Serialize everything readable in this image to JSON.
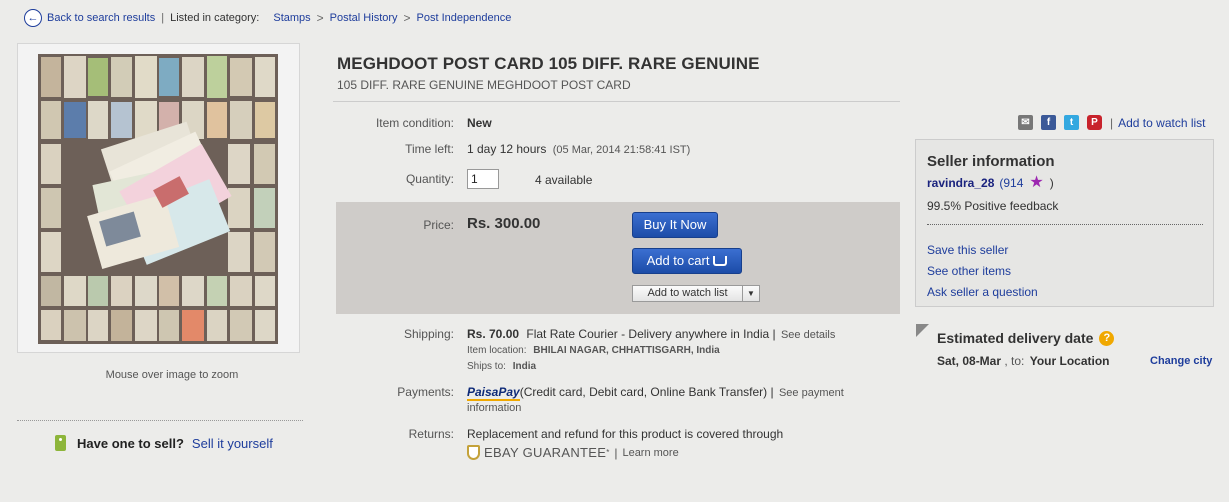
{
  "breadcrumb": {
    "back": "Back to search results",
    "sep": "|",
    "listed_in": "Listed in category:",
    "items": [
      "Stamps",
      "Postal History",
      "Post Independence"
    ],
    "gt": ">"
  },
  "image": {
    "zoom_hint": "Mouse over image to zoom"
  },
  "sell": {
    "question": "Have one to sell?",
    "link": "Sell it yourself"
  },
  "item": {
    "title": "MEGHDOOT POST CARD 105 DIFF. RARE GENUINE",
    "subtitle": "105 DIFF. RARE GENUINE MEGHDOOT POST CARD",
    "condition_label": "Item condition:",
    "condition": "New",
    "time_label": "Time left:",
    "time_left": "1 day 12 hours",
    "end_time": "(05 Mar, 2014  21:58:41 IST)",
    "qty_label": "Quantity:",
    "qty_value": "1",
    "available": "4 available",
    "price_label": "Price:",
    "price": "Rs. 300.00",
    "buy_now": "Buy It Now",
    "add_to_cart": "Add to cart",
    "add_watch": "Add to watch list",
    "shipping_label": "Shipping:",
    "shipping_cost": "Rs. 70.00",
    "shipping_desc": "Flat Rate Courier - Delivery anywhere in India |",
    "see_details": "See details",
    "item_location_label": "Item location:",
    "item_location": "BHILAI NAGAR, CHHATTISGARH, India",
    "ships_to_label": "Ships to:",
    "ships_to": "India",
    "payments_label": "Payments:",
    "paisapay": "PaisaPay",
    "payments_desc": "(Credit card, Debit card, Online Bank Transfer)  |",
    "see_payment": "See payment",
    "payment_info": "information",
    "returns_label": "Returns:",
    "returns_desc": "Replacement and refund for this product is covered through",
    "guarantee": "EBAY GUARANTEE",
    "guarantee_mark": "*",
    "learn_more": "Learn more"
  },
  "share": {
    "watch_link": "Add to watch list",
    "sep": "|"
  },
  "seller": {
    "heading": "Seller information",
    "name": "ravindra_28",
    "score_open": "(914",
    "score_close": ")",
    "feedback": "99.5% Positive feedback",
    "save": "Save this seller",
    "see_items": "See other items",
    "ask": "Ask seller a question"
  },
  "delivery": {
    "heading": "Estimated delivery date",
    "date": "Sat, 08-Mar",
    "to": ", to:",
    "location": "Your Location",
    "change": "Change city"
  },
  "colors": {
    "link": "#1e3d9c",
    "button": "#2a5cc0",
    "price_box": "#cfccc9",
    "paypal_blue": "#0e2a78"
  }
}
